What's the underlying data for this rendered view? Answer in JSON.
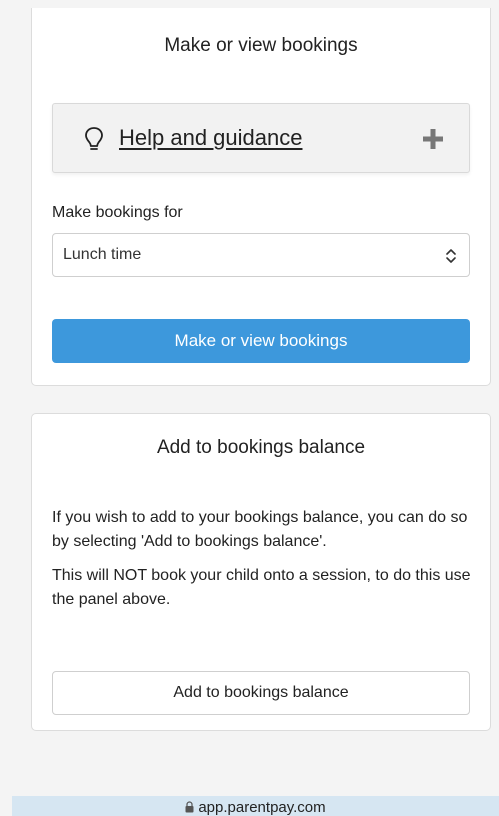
{
  "bookings_panel": {
    "title": "Make or view bookings",
    "help": {
      "label": "Help and guidance",
      "icon": "lightbulb-icon",
      "expand_icon": "plus-icon"
    },
    "make_bookings_for": {
      "label": "Make bookings for",
      "selected": "Lunch time"
    },
    "button_label": "Make or view bookings"
  },
  "balance_panel": {
    "title": "Add to bookings balance",
    "paragraph_1": "If you wish to add to your bookings balance, you can do so by selecting 'Add to bookings balance'.",
    "paragraph_2": "This will NOT book your child onto a session, to do this use the panel above.",
    "button_label": "Add to bookings balance"
  },
  "browser": {
    "url": "app.parentpay.com",
    "icon": "lock-icon"
  },
  "colors": {
    "primary_button": "#3d98dc",
    "page_background": "#f4f4f4",
    "help_panel_background": "#f2f2f2",
    "url_bar_background": "#d6e6f2"
  }
}
